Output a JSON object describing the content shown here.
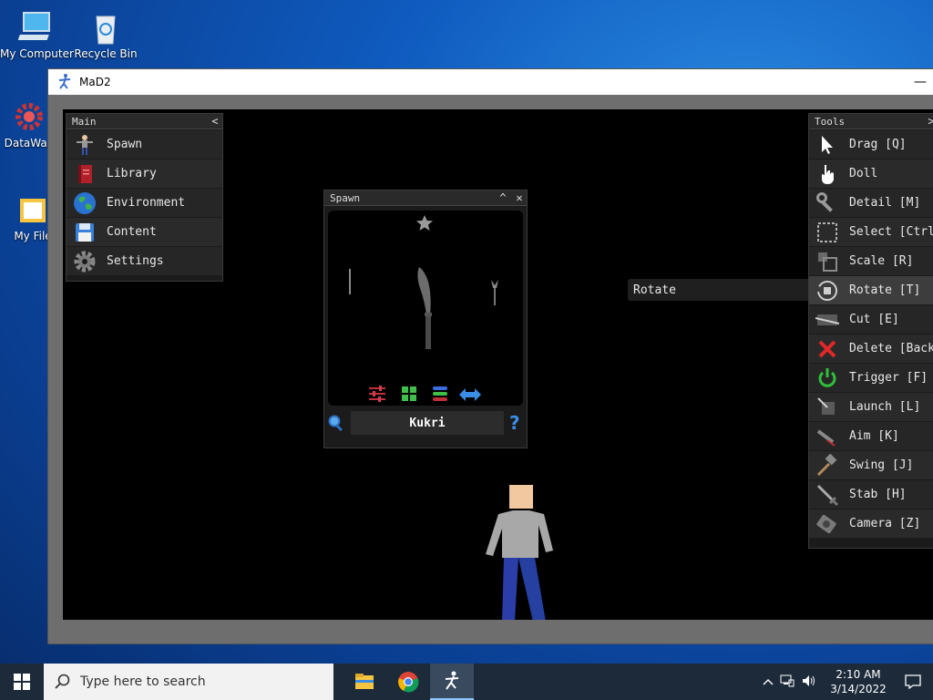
{
  "desktop": {
    "icons": [
      {
        "label": "My Computer"
      },
      {
        "label": "Recycle Bin"
      },
      {
        "label": "DataWag"
      },
      {
        "label": "My File"
      }
    ]
  },
  "window": {
    "title": "MaD2",
    "minimize": "—"
  },
  "main_panel": {
    "title": "Main",
    "collapse": "<",
    "items": [
      {
        "label": "Spawn",
        "icon": "figure-icon"
      },
      {
        "label": "Library",
        "icon": "book-icon"
      },
      {
        "label": "Environment",
        "icon": "globe-icon"
      },
      {
        "label": "Content",
        "icon": "floppy-icon"
      },
      {
        "label": "Settings",
        "icon": "gear-icon"
      }
    ]
  },
  "spawn_panel": {
    "title": "Spawn",
    "collapse": "^",
    "close": "✕",
    "search_value": "Kukri",
    "help": "?"
  },
  "tooltip": {
    "text": "Rotate"
  },
  "tools_panel": {
    "title": "Tools",
    "collapse": ">",
    "items": [
      {
        "label": "Drag [Q]"
      },
      {
        "label": "Doll"
      },
      {
        "label": "Detail [M]"
      },
      {
        "label": "Select [Ctrl"
      },
      {
        "label": "Scale [R]"
      },
      {
        "label": "Rotate [T]"
      },
      {
        "label": "Cut [E]"
      },
      {
        "label": "Delete [Back"
      },
      {
        "label": "Trigger [F]"
      },
      {
        "label": "Launch [L]"
      },
      {
        "label": "Aim [K]"
      },
      {
        "label": "Swing [J]"
      },
      {
        "label": "Stab [H]"
      },
      {
        "label": "Camera [Z]"
      }
    ]
  },
  "taskbar": {
    "search_placeholder": "Type here to search",
    "time": "2:10 AM",
    "date": "3/14/2022"
  },
  "colors": {
    "desktop": "#0f5bbf",
    "viewport": "#000000",
    "panel": "#1b1b1b",
    "accent_blue": "#3a8ee6",
    "delete_red": "#e02828",
    "trigger_green": "#2fbf3a"
  }
}
